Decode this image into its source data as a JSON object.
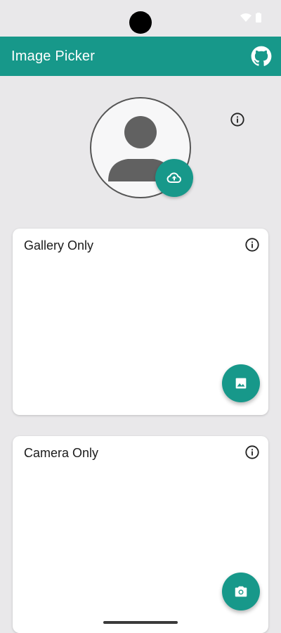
{
  "app_bar": {
    "title": "Image Picker",
    "background": "#17988a"
  },
  "icons": {
    "github": "github-icon",
    "upload": "cloud-upload-icon",
    "info": "info-icon",
    "gallery": "image-icon",
    "camera": "camera-icon",
    "avatar": "person-icon"
  },
  "cards": {
    "gallery": {
      "title": "Gallery Only"
    },
    "camera": {
      "title": "Camera Only"
    }
  },
  "colors": {
    "accent": "#17988a",
    "page_bg": "#e9e8ea"
  }
}
